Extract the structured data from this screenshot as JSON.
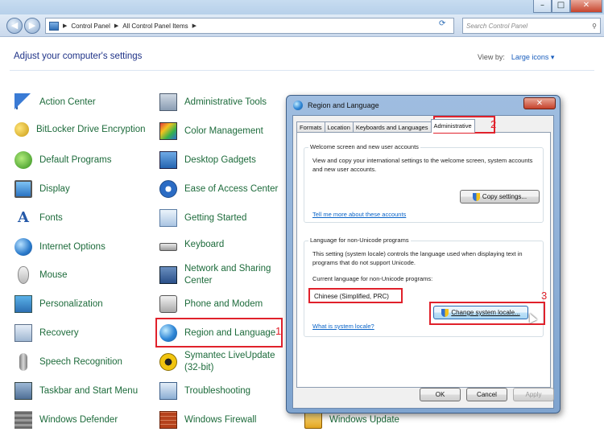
{
  "window": {
    "controls": {
      "minimize": "–",
      "maximize": "□",
      "close": "✕"
    },
    "nav": {
      "back": "◀",
      "forward": "▶"
    },
    "breadcrumb": [
      "Control Panel",
      "All Control Panel Items"
    ],
    "search_placeholder": "Search Control Panel"
  },
  "header": {
    "title": "Adjust your computer's settings",
    "view_by_label": "View by:",
    "view_by_value": "Large icons ▾"
  },
  "items_col1": [
    {
      "label": "Action Center",
      "icon": "flag-icon"
    },
    {
      "label": "BitLocker Drive Encryption",
      "icon": "key-icon"
    },
    {
      "label": "Default Programs",
      "icon": "default-programs-icon"
    },
    {
      "label": "Display",
      "icon": "monitor-icon"
    },
    {
      "label": "Fonts",
      "icon": "font-icon"
    },
    {
      "label": "Internet Options",
      "icon": "globe-icon"
    },
    {
      "label": "Mouse",
      "icon": "mouse-icon"
    },
    {
      "label": "Personalization",
      "icon": "personalization-icon"
    },
    {
      "label": "Recovery",
      "icon": "recovery-icon"
    },
    {
      "label": "Speech Recognition",
      "icon": "microphone-icon"
    },
    {
      "label": "Taskbar and Start Menu",
      "icon": "taskbar-icon"
    },
    {
      "label": "Windows Defender",
      "icon": "wall-icon"
    }
  ],
  "items_col2": [
    {
      "label": "Administrative Tools",
      "icon": "admin-tools-icon"
    },
    {
      "label": "Color Management",
      "icon": "color-icon"
    },
    {
      "label": "Desktop Gadgets",
      "icon": "gadgets-icon"
    },
    {
      "label": "Ease of Access Center",
      "icon": "accessibility-icon"
    },
    {
      "label": "Getting Started",
      "icon": "getting-started-icon"
    },
    {
      "label": "Keyboard",
      "icon": "keyboard-icon"
    },
    {
      "label": "Network and Sharing Center",
      "icon": "network-icon"
    },
    {
      "label": "Phone and Modem",
      "icon": "phone-icon"
    },
    {
      "label": "Region and Language",
      "icon": "region-globe-icon"
    },
    {
      "label": "Symantec LiveUpdate (32-bit)",
      "icon": "symantec-icon"
    },
    {
      "label": "Troubleshooting",
      "icon": "troubleshooting-icon"
    },
    {
      "label": "Windows Firewall",
      "icon": "firewall-icon"
    }
  ],
  "col3_partial": {
    "item_bottom": "Windows Update"
  },
  "annotations": {
    "n1": "1",
    "n2": "2",
    "n3": "3"
  },
  "dialog": {
    "title": "Region and Language",
    "close": "✕",
    "tabs": [
      "Formats",
      "Location",
      "Keyboards and Languages",
      "Administrative"
    ],
    "welcome": {
      "title": "Welcome screen and new user accounts",
      "text": "View and copy your international settings to the welcome screen, system accounts and new user accounts.",
      "button": "Copy settings...",
      "link": "Tell me more about these accounts"
    },
    "nonunicode": {
      "title": "Language for non-Unicode programs",
      "text": "This setting (system locale) controls the language used when displaying text in programs that do not support Unicode.",
      "current_label": "Current language for non-Unicode programs:",
      "current_value": "Chinese (Simplified, PRC)",
      "button": "Change system locale...",
      "link": "What is system locale?"
    },
    "buttons": {
      "ok": "OK",
      "cancel": "Cancel",
      "apply": "Apply"
    }
  },
  "colors": {
    "link_green": "#1d6b3b",
    "heading_blue": "#1e3287",
    "annotation_red": "#e0212b",
    "link_blue": "#0a64c8"
  }
}
